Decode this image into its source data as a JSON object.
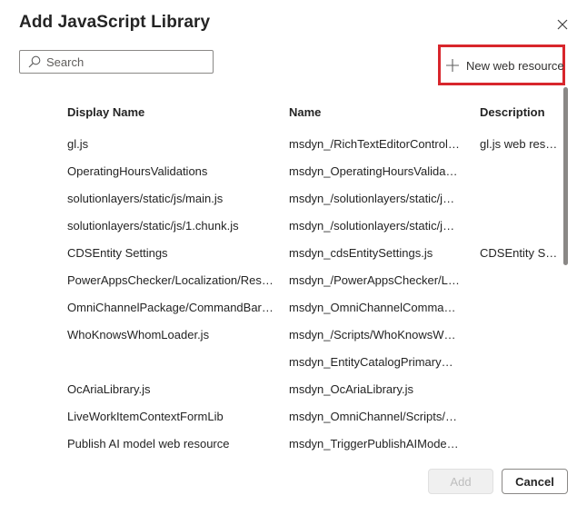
{
  "dialog": {
    "title": "Add JavaScript Library",
    "close_icon": "close-icon"
  },
  "search": {
    "placeholder": "Search",
    "value": "",
    "icon": "search-icon"
  },
  "toolbar": {
    "new_web_resource_label": "New web resource",
    "new_icon": "plus-icon",
    "highlight_color": "#d8262c"
  },
  "grid": {
    "columns": [
      "Display Name",
      "Name",
      "Description"
    ],
    "rows": [
      {
        "display_name": "gl.js",
        "name": "msdyn_/RichTextEditorControl/li...",
        "description": "gl.js web reso..."
      },
      {
        "display_name": "OperatingHoursValidations",
        "name": "msdyn_OperatingHoursValidatio...",
        "description": ""
      },
      {
        "display_name": "solutionlayers/static/js/main.js",
        "name": "msdyn_/solutionlayers/static/js/...",
        "description": ""
      },
      {
        "display_name": "solutionlayers/static/js/1.chunk.js",
        "name": "msdyn_/solutionlayers/static/js/1...",
        "description": ""
      },
      {
        "display_name": "CDSEntity Settings",
        "name": "msdyn_cdsEntitySettings.js",
        "description": "CDSEntity Sett..."
      },
      {
        "display_name": "PowerAppsChecker/Localization/Resou...",
        "name": "msdyn_/PowerAppsChecker/Loca...",
        "description": ""
      },
      {
        "display_name": "OmniChannelPackage/CommandBarAc...",
        "name": "msdyn_OmniChannelCommandB...",
        "description": ""
      },
      {
        "display_name": "WhoKnowsWhomLoader.js",
        "name": "msdyn_/Scripts/WhoKnowsWho...",
        "description": ""
      },
      {
        "display_name": "",
        "name": "msdyn_EntityCatalogPrimaryField",
        "description": ""
      },
      {
        "display_name": "OcAriaLibrary.js",
        "name": "msdyn_OcAriaLibrary.js",
        "description": ""
      },
      {
        "display_name": "LiveWorkItemContextFormLib",
        "name": "msdyn_OmniChannel/Scripts/Liv...",
        "description": ""
      },
      {
        "display_name": "Publish AI model web resource",
        "name": "msdyn_TriggerPublishAIModel.js",
        "description": ""
      }
    ]
  },
  "footer": {
    "add_label": "Add",
    "cancel_label": "Cancel",
    "add_disabled": true
  }
}
